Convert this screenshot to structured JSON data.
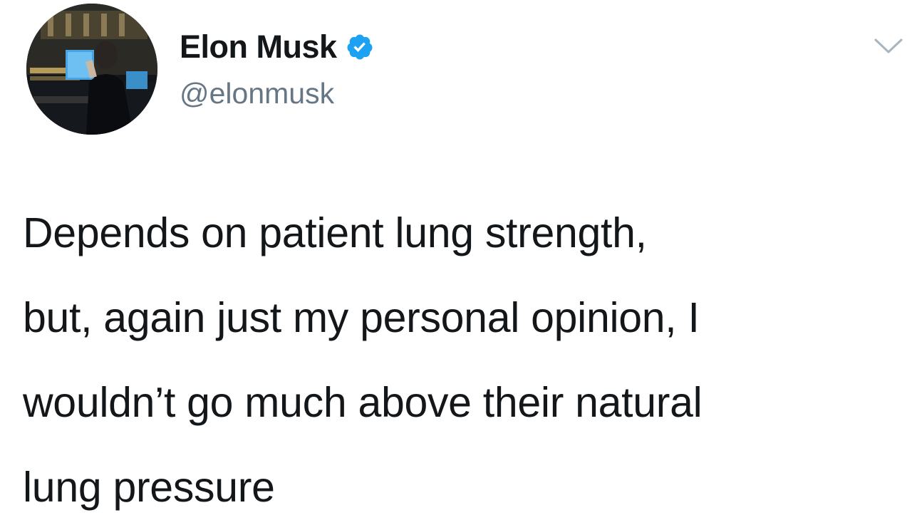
{
  "author": {
    "display_name": "Elon Musk",
    "handle": "@elonmusk",
    "verified": true,
    "verified_icon": "verified-badge-icon",
    "verified_color": "#1da1f2"
  },
  "menu": {
    "icon": "chevron-down-icon",
    "color": "#a9b4bd"
  },
  "tweet": {
    "lines": [
      "Depends on patient lung strength,",
      "but, again just my personal opinion, I",
      "wouldn’t go much above their natural",
      "lung pressure"
    ]
  }
}
